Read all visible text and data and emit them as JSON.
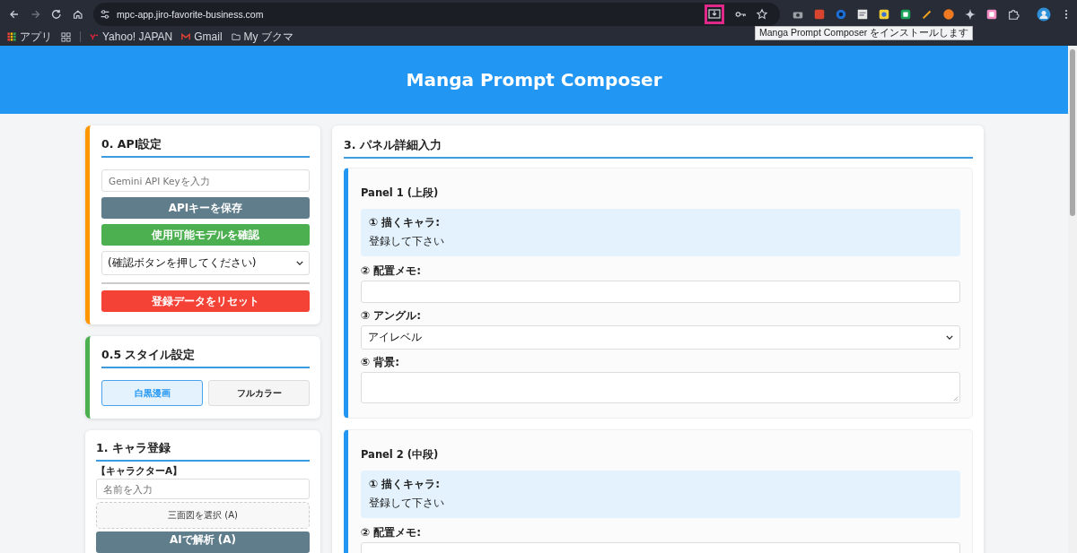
{
  "browser": {
    "url": "mpc-app.jiro-favorite-business.com",
    "tooltip": "Manga Prompt Composer をインストールします",
    "bookmarks": [
      {
        "kind": "apps",
        "label": "アプリ"
      },
      {
        "kind": "yahoo",
        "label": "Yahoo! JAPAN"
      },
      {
        "kind": "gmail",
        "label": "Gmail"
      },
      {
        "kind": "folder",
        "label": "My ブクマ"
      }
    ]
  },
  "header": {
    "title": "Manga Prompt Composer"
  },
  "left_cards": [
    {
      "title": "0. API設定",
      "color": "#ff9800",
      "items": [
        {
          "kind": "input",
          "placeholder": "Gemini API Keyを入力"
        },
        {
          "kind": "button",
          "label": "APIキーを保存",
          "color": "#607d8b"
        },
        {
          "kind": "button",
          "label": "使用可能モデルを確認",
          "color": "#4caf50"
        },
        {
          "kind": "select",
          "value": "(確認ボタンを押してください)"
        },
        {
          "kind": "divider"
        },
        {
          "kind": "button",
          "label": "登録データをリセット",
          "color": "#f44336"
        }
      ]
    },
    {
      "title": "0.5 スタイル設定",
      "color": "#4caf50",
      "items": [
        {
          "kind": "toggle",
          "options": [
            {
              "label": "白黒漫画",
              "selected": true
            },
            {
              "label": "フルカラー",
              "selected": false
            }
          ]
        }
      ]
    },
    {
      "title": "1. キャラ登録",
      "items": [
        {
          "kind": "label",
          "text": "【キャラクターA】"
        },
        {
          "kind": "input",
          "placeholder": "名前を入力"
        },
        {
          "kind": "dropzone",
          "label": "三面図を選択 (A)"
        },
        {
          "kind": "button",
          "label": "AIで解析 (A)",
          "color": "#607d8b"
        }
      ]
    }
  ],
  "panel_section": {
    "title": "3. パネル詳細入力",
    "panels": [
      {
        "title": "Panel 1 (上段)",
        "chara_label": "① 描くキャラ:",
        "chara_value": "登録して下さい",
        "fields": [
          {
            "kind": "input",
            "label": "② 配置メモ:"
          },
          {
            "kind": "select",
            "label": "③ アングル:",
            "value": "アイレベル"
          },
          {
            "kind": "textarea",
            "label": "⑤ 背景:"
          }
        ]
      },
      {
        "title": "Panel 2 (中段)",
        "chara_label": "① 描くキャラ:",
        "chara_value": "登録して下さい",
        "fields": [
          {
            "kind": "input",
            "label": "② 配置メモ:"
          }
        ]
      }
    ]
  }
}
